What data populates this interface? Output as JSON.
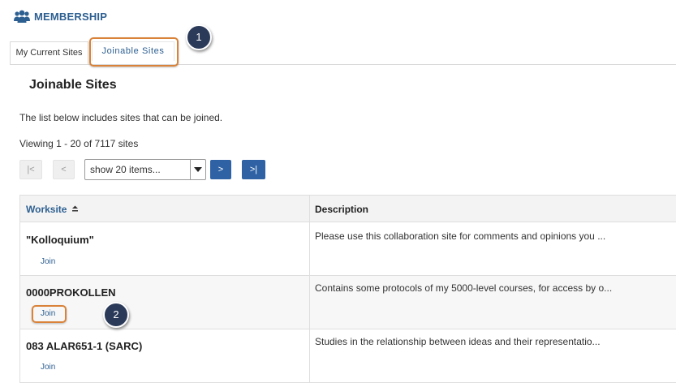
{
  "tool": {
    "title": "MEMBERSHIP",
    "icon": "users-icon"
  },
  "tabs": [
    {
      "label": "My Current Sites"
    },
    {
      "label": "Joinable Sites"
    }
  ],
  "callouts": [
    "1",
    "2"
  ],
  "page": {
    "heading": "Joinable Sites",
    "intro": "The list below includes sites that can be joined.",
    "viewing": "Viewing 1 - 20 of 7117 sites"
  },
  "pager": {
    "first": "|<",
    "prev": "<",
    "page_size": "show 20 items...",
    "next": ">",
    "last": ">|"
  },
  "table": {
    "columns": [
      "Worksite",
      "Description"
    ],
    "rows": [
      {
        "name": "\"Kolloquium\"",
        "action": "Join",
        "description": "Please use this collaboration site for comments and opinions you ..."
      },
      {
        "name": "0000PROKOLLEN",
        "action": "Join",
        "description": "Contains some protocols of my 5000-level courses, for access by o..."
      },
      {
        "name": "083 ALAR651-1 (SARC)",
        "action": "Join",
        "description": "Studies in the relationship between ideas and their representatio..."
      }
    ]
  },
  "colors": {
    "accent": "#2d5f91",
    "button": "#2e62a4",
    "highlight": "#d98238",
    "badge": "#2b3a59"
  }
}
